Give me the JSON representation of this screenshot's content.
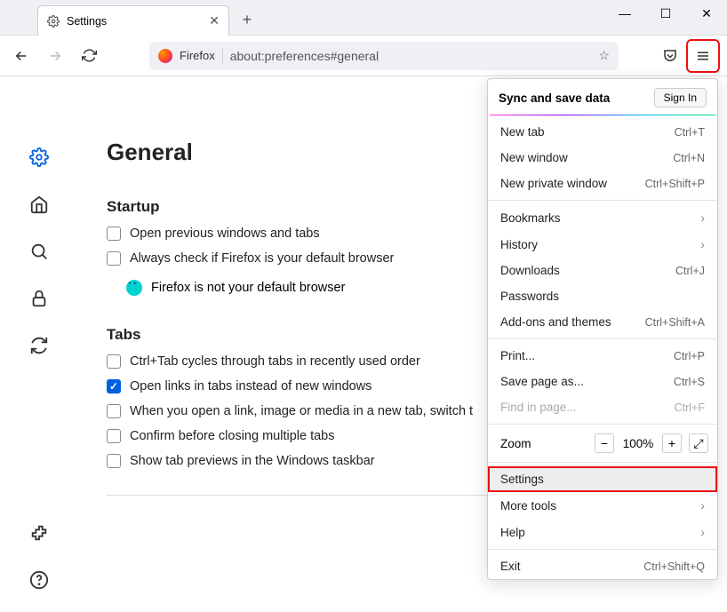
{
  "titlebar": {
    "tab_title": "Settings",
    "tab_icon": "gear-icon"
  },
  "toolbar": {
    "firefox_label": "Firefox",
    "address": "about:preferences#general"
  },
  "page": {
    "heading": "General",
    "startup": {
      "title": "Startup",
      "open_prev": "Open previous windows and tabs",
      "always_check": "Always check if Firefox is your default browser",
      "not_default": "Firefox is not your default browser"
    },
    "tabs": {
      "title": "Tabs",
      "ctrl_tab": "Ctrl+Tab cycles through tabs in recently used order",
      "open_links": "Open links in tabs instead of new windows",
      "switch_to": "When you open a link, image or media in a new tab, switch t",
      "confirm_close": "Confirm before closing multiple tabs",
      "taskbar_preview": "Show tab previews in the Windows taskbar"
    }
  },
  "menu": {
    "sync_title": "Sync and save data",
    "sign_in": "Sign In",
    "items1": [
      {
        "label": "New tab",
        "shortcut": "Ctrl+T"
      },
      {
        "label": "New window",
        "shortcut": "Ctrl+N"
      },
      {
        "label": "New private window",
        "shortcut": "Ctrl+Shift+P"
      }
    ],
    "items2": [
      {
        "label": "Bookmarks",
        "shortcut": "",
        "chevron": true
      },
      {
        "label": "History",
        "shortcut": "",
        "chevron": true
      },
      {
        "label": "Downloads",
        "shortcut": "Ctrl+J"
      },
      {
        "label": "Passwords",
        "shortcut": ""
      },
      {
        "label": "Add-ons and themes",
        "shortcut": "Ctrl+Shift+A"
      }
    ],
    "items3": [
      {
        "label": "Print...",
        "shortcut": "Ctrl+P"
      },
      {
        "label": "Save page as...",
        "shortcut": "Ctrl+S"
      },
      {
        "label": "Find in page...",
        "shortcut": "Ctrl+F",
        "disabled": true
      }
    ],
    "zoom": {
      "label": "Zoom",
      "value": "100%"
    },
    "settings": "Settings",
    "more_tools": "More tools",
    "help": "Help",
    "exit": {
      "label": "Exit",
      "shortcut": "Ctrl+Shift+Q"
    }
  }
}
